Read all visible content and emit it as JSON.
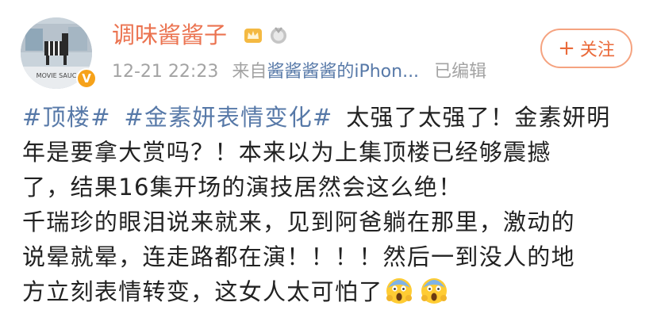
{
  "user": {
    "name": "调味酱酱子",
    "avatar_text": "MOVIE SAUC",
    "verified_badge": "V"
  },
  "meta": {
    "timestamp": "12-21 22:23",
    "source_prefix": "来自",
    "source": "酱酱酱酱的iPhon...",
    "edited": "已编辑"
  },
  "follow_button": {
    "icon": "+",
    "label": "关注"
  },
  "post": {
    "tag1": "#顶楼#",
    "tag2": "#金素妍表情变化#",
    "line1_text": "太强了太强了！金素妍明",
    "line2": "年是要拿大赏吗？！本来以为上集顶楼已经够震撼",
    "line3": "了，结果16集开场的演技居然会这么绝！",
    "line4": "千瑞珍的眼泪说来就来，见到阿爸躺在那里，激动的",
    "line5": "说晕就晕，连走路都在演！！！！然后一到没人的地",
    "line6_text": "方立刻表情转变，这女人太可怕了",
    "emojis": [
      "scream-emoji",
      "scream-emoji"
    ]
  },
  "colors": {
    "username": "#eb7350",
    "link": "#5779a8",
    "meta": "#a3a3a3",
    "follow": "#ea6a3a"
  }
}
